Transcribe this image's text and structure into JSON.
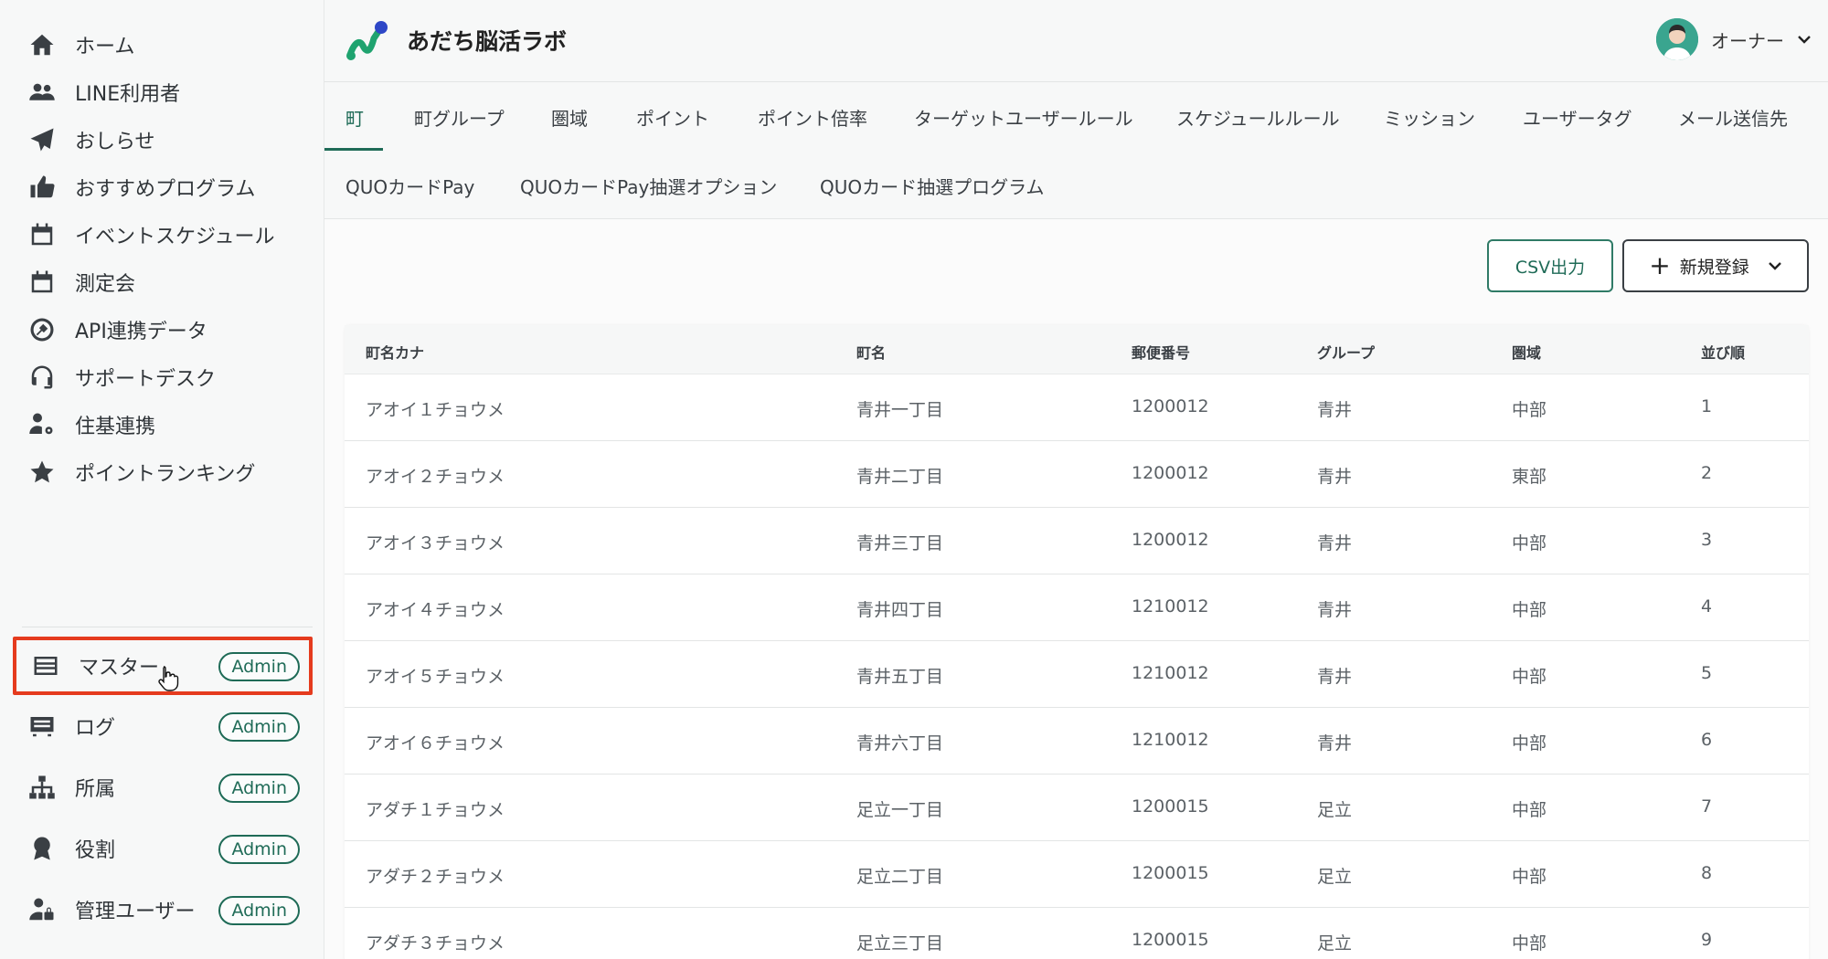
{
  "sidebar": {
    "items": [
      {
        "label": "ホーム",
        "icon": "home-icon"
      },
      {
        "label": "LINE利用者",
        "icon": "users-icon"
      },
      {
        "label": "おしらせ",
        "icon": "paper-plane-icon"
      },
      {
        "label": "おすすめプログラム",
        "icon": "thumbs-up-icon"
      },
      {
        "label": "イベントスケジュール",
        "icon": "calendar-icon"
      },
      {
        "label": "測定会",
        "icon": "calendar-blank-icon"
      },
      {
        "label": "API連携データ",
        "icon": "api-link-icon"
      },
      {
        "label": "サポートデスク",
        "icon": "headset-icon"
      },
      {
        "label": "住基連携",
        "icon": "user-gear-icon"
      },
      {
        "label": "ポイントランキング",
        "icon": "star-icon"
      },
      {
        "label": "マスター",
        "icon": "master-list-icon",
        "badge": "Admin"
      },
      {
        "label": "ログ",
        "icon": "log-icon",
        "badge": "Admin"
      },
      {
        "label": "所属",
        "icon": "org-tree-icon",
        "badge": "Admin"
      },
      {
        "label": "役割",
        "icon": "role-badge-icon",
        "badge": "Admin"
      },
      {
        "label": "管理ユーザー",
        "icon": "admin-user-icon",
        "badge": "Admin"
      }
    ]
  },
  "header": {
    "title": "あだち脳活ラボ",
    "user_name": "オーナー"
  },
  "tabs": [
    "町",
    "町グループ",
    "圏域",
    "ポイント",
    "ポイント倍率",
    "ターゲットユーザールール",
    "スケジュールルール",
    "ミッション",
    "ユーザータグ",
    "メール送信先",
    "QUOカードPay",
    "QUOカードPay抽選オプション",
    "QUOカード抽選プログラム"
  ],
  "actions": {
    "csv_label": "CSV出力",
    "new_label": "新規登録"
  },
  "table": {
    "columns": [
      "町名カナ",
      "町名",
      "郵便番号",
      "グループ",
      "圏域",
      "並び順"
    ],
    "rows": [
      [
        "アオイ１チョウメ",
        "青井一丁目",
        "1200012",
        "青井",
        "中部",
        "1"
      ],
      [
        "アオイ２チョウメ",
        "青井二丁目",
        "1200012",
        "青井",
        "東部",
        "2"
      ],
      [
        "アオイ３チョウメ",
        "青井三丁目",
        "1200012",
        "青井",
        "中部",
        "3"
      ],
      [
        "アオイ４チョウメ",
        "青井四丁目",
        "1210012",
        "青井",
        "中部",
        "4"
      ],
      [
        "アオイ５チョウメ",
        "青井五丁目",
        "1210012",
        "青井",
        "中部",
        "5"
      ],
      [
        "アオイ６チョウメ",
        "青井六丁目",
        "1210012",
        "青井",
        "中部",
        "6"
      ],
      [
        "アダチ１チョウメ",
        "足立一丁目",
        "1200015",
        "足立",
        "中部",
        "7"
      ],
      [
        "アダチ２チョウメ",
        "足立二丁目",
        "1200015",
        "足立",
        "中部",
        "8"
      ],
      [
        "アダチ３チョウメ",
        "足立三丁目",
        "1200015",
        "足立",
        "中部",
        "9"
      ]
    ]
  },
  "colors": {
    "accent": "#1f6b57",
    "highlight": "#e53b1e"
  }
}
